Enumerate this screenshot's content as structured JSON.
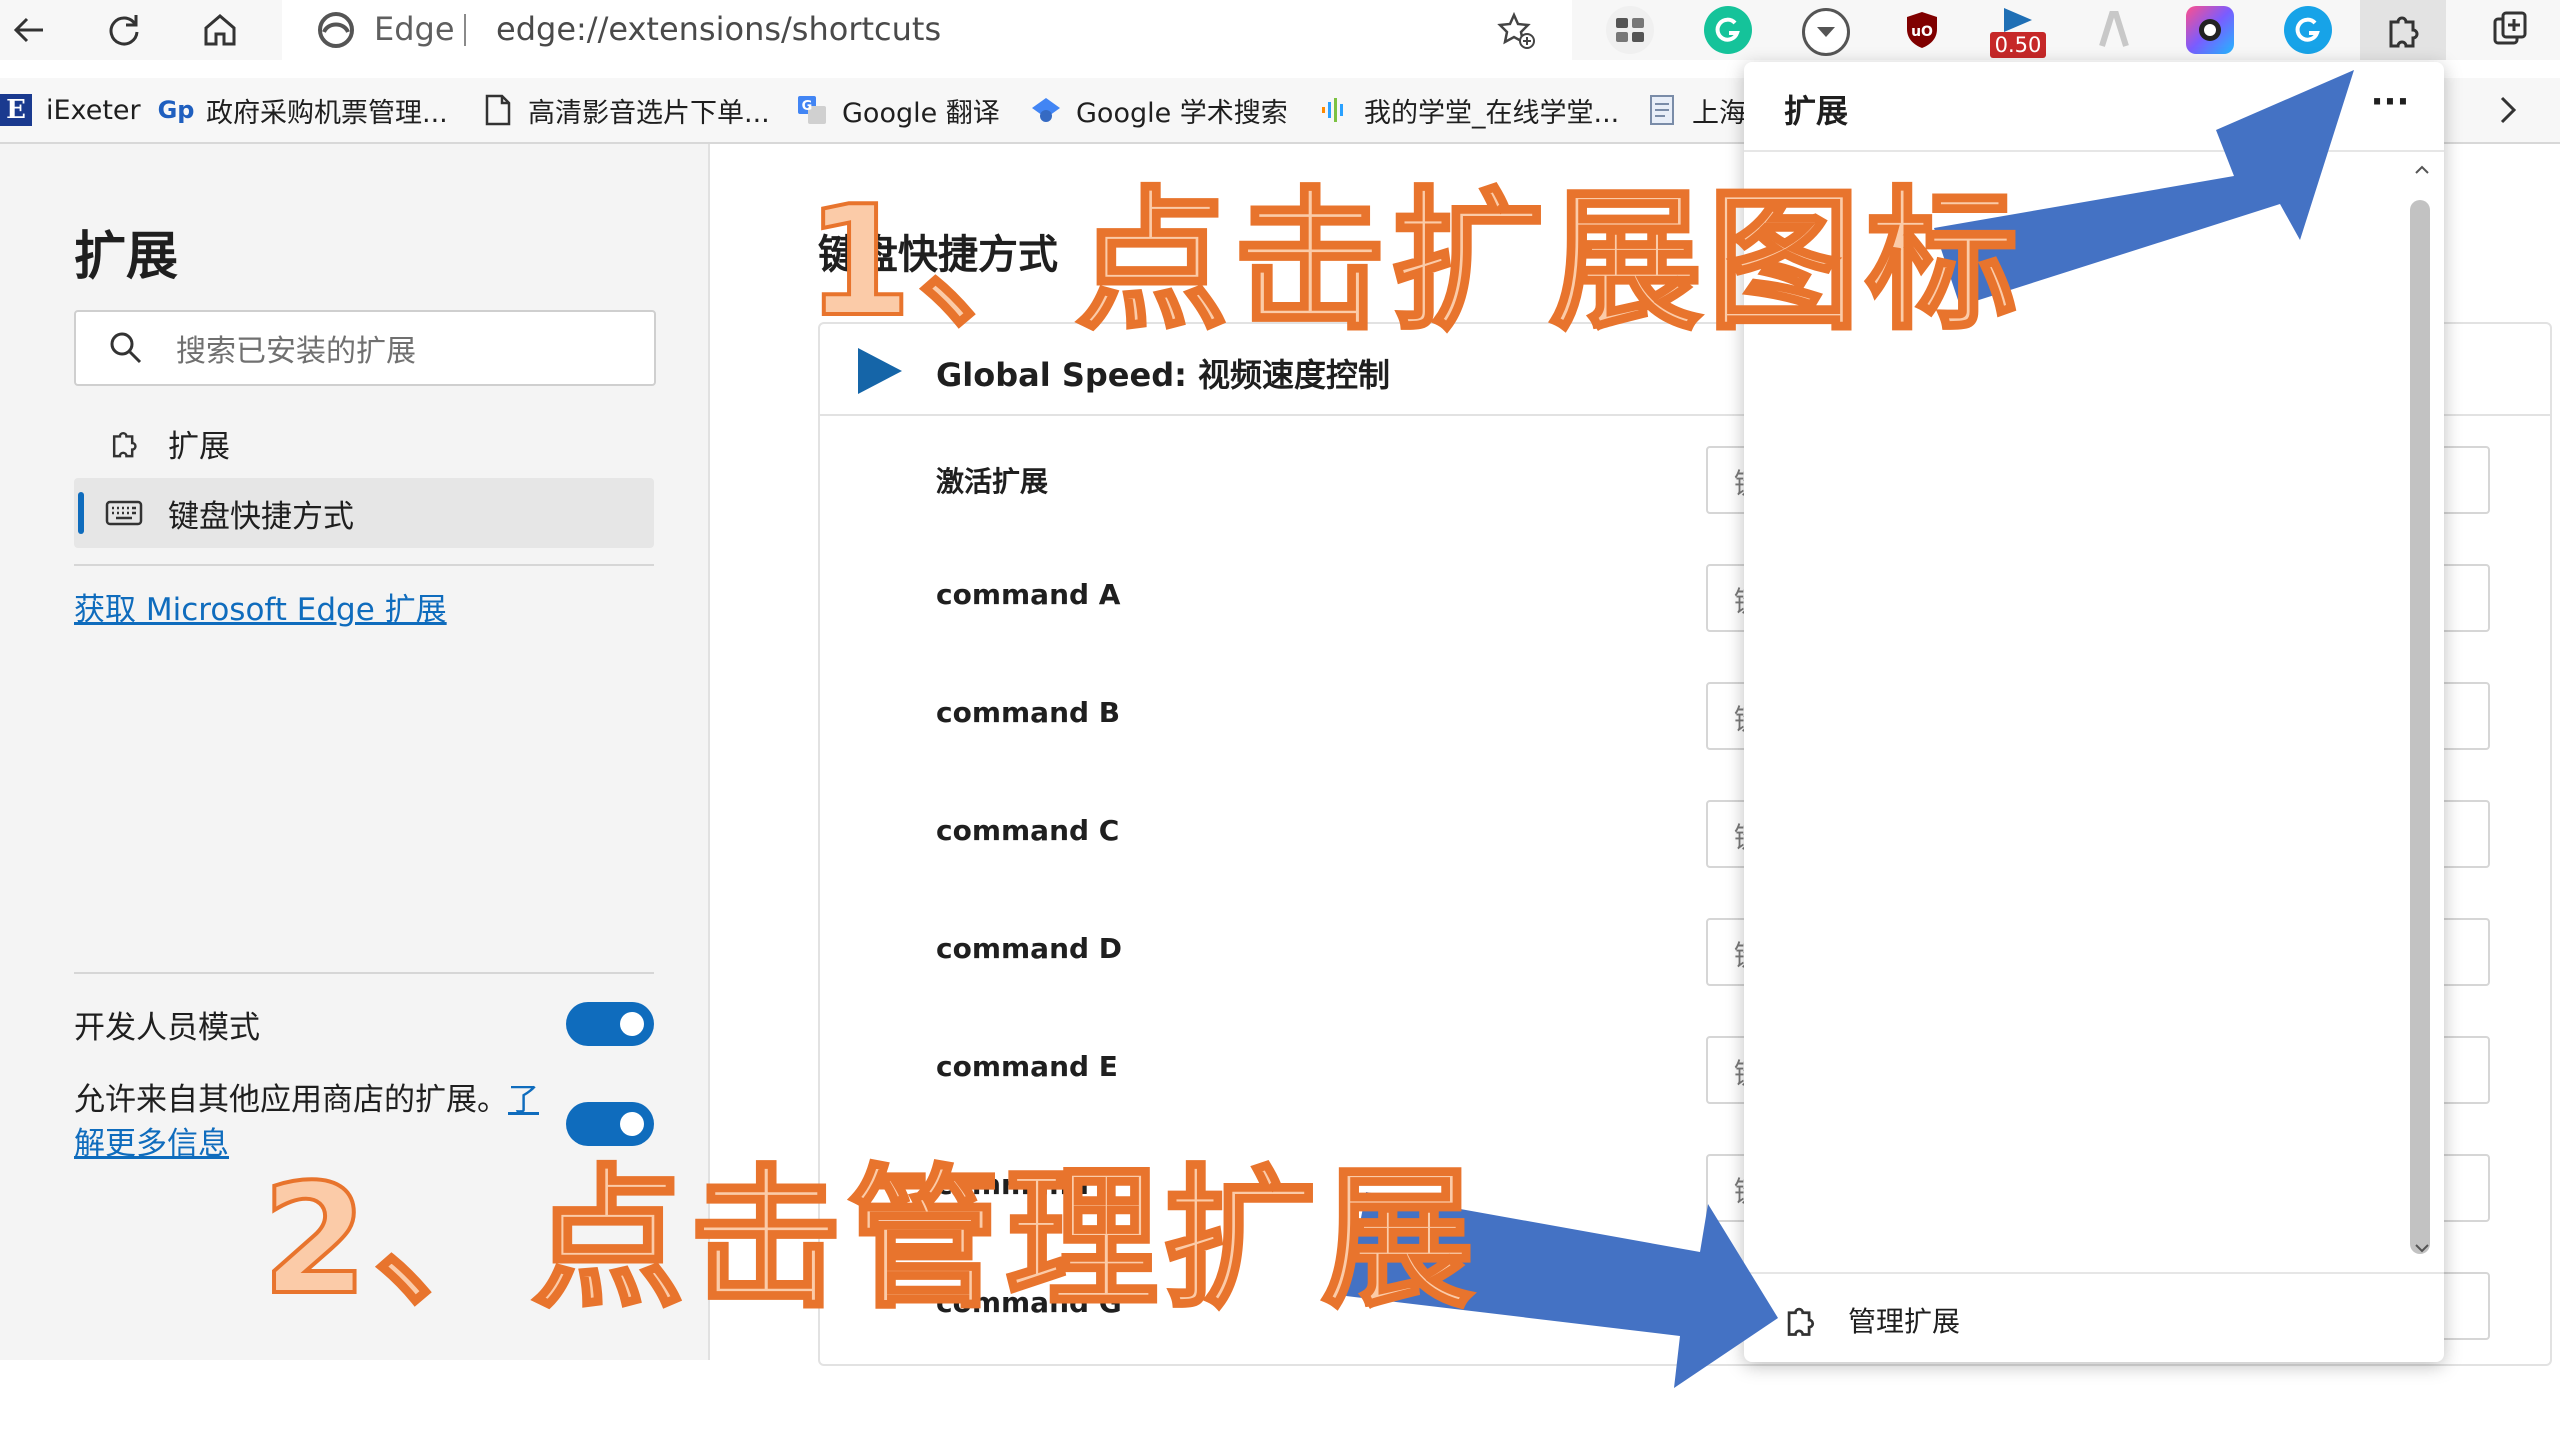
{
  "toolbar": {
    "edge_label": "Edge",
    "url": "edge://extensions/shortcuts",
    "badge": "0.50"
  },
  "bookmarks": [
    {
      "label": "iExeter"
    },
    {
      "label": "政府采购机票管理..."
    },
    {
      "label": "高清影音选片下单..."
    },
    {
      "label": "Google 翻译"
    },
    {
      "label": "Google 学术搜索"
    },
    {
      "label": "我的学堂_在线学堂..."
    },
    {
      "label": "上海"
    }
  ],
  "sidebar": {
    "title": "扩展",
    "search_placeholder": "搜索已安装的扩展",
    "nav": [
      {
        "label": "扩展",
        "icon": "puzzle-icon"
      },
      {
        "label": "键盘快捷方式",
        "icon": "keyboard-icon",
        "active": true
      }
    ],
    "get_extensions_link": "获取 Microsoft Edge 扩展",
    "dev_mode_label": "开发人员模式",
    "dev_mode_on": true,
    "allow_other_stores_label": "允许来自其他应用商店的扩展。",
    "learn_more_a": "了",
    "learn_more_b": "解更多信息",
    "allow_other_stores_on": true
  },
  "main": {
    "title": "键盘快捷方式",
    "extension_name": "Global Speed: 视频速度控制",
    "input_placeholder": "键",
    "commands": [
      {
        "label": "激活扩展"
      },
      {
        "label": "command A"
      },
      {
        "label": "command B"
      },
      {
        "label": "command C"
      },
      {
        "label": "command D"
      },
      {
        "label": "command E"
      },
      {
        "label": "command F"
      },
      {
        "label": "command G"
      }
    ]
  },
  "popup": {
    "title": "扩展",
    "more_label": "···",
    "manage_label": "管理扩展"
  },
  "annotations": {
    "step1": "1、点击扩展图标",
    "step2": "2、点击管理扩展",
    "arrow_color": "#4472c4",
    "text_color": "#fbcba8",
    "outline_color": "#e8742d"
  },
  "colors": {
    "accent": "#0f6cbd"
  }
}
